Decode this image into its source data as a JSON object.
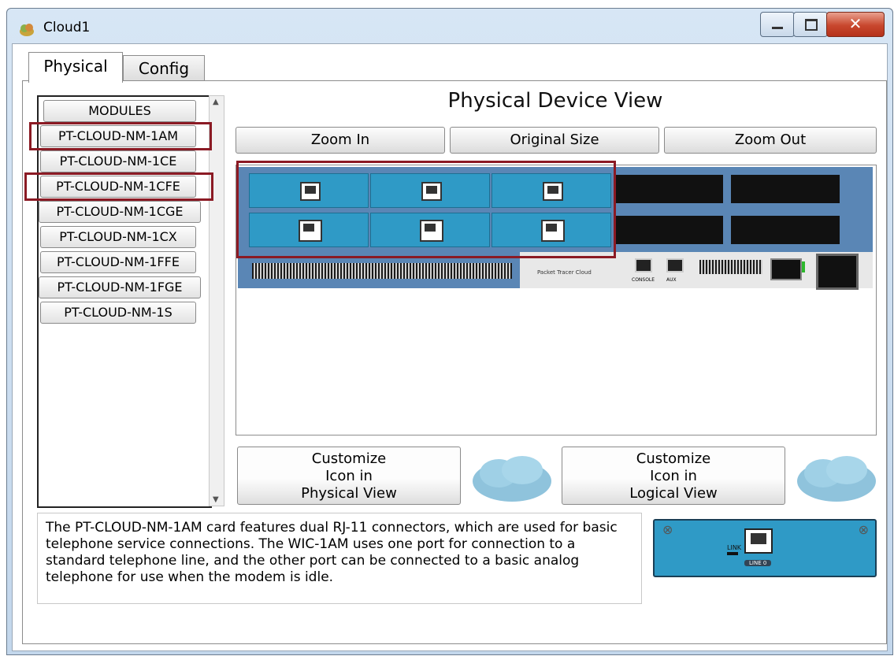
{
  "window": {
    "title": "Cloud1",
    "icon": "cloud-device-icon",
    "controls": [
      "minimize-icon",
      "maximize-icon",
      "close-icon"
    ]
  },
  "tabs": [
    {
      "label": "Physical",
      "active": true
    },
    {
      "label": "Config",
      "active": false
    }
  ],
  "modules": {
    "header": "MODULES",
    "items": [
      "PT-CLOUD-NM-1AM",
      "PT-CLOUD-NM-1CE",
      "PT-CLOUD-NM-1CFE",
      "PT-CLOUD-NM-1CGE",
      "PT-CLOUD-NM-1CX",
      "PT-CLOUD-NM-1FFE",
      "PT-CLOUD-NM-1FGE",
      "PT-CLOUD-NM-1S"
    ],
    "highlighted": [
      "PT-CLOUD-NM-1AM",
      "PT-CLOUD-NM-1CFE"
    ]
  },
  "device_view": {
    "title": "Physical Device View",
    "zoom_in": "Zoom In",
    "original_size": "Original Size",
    "zoom_out": "Zoom Out",
    "device_label": "Packet Tracer Cloud",
    "port_labels": [
      "CONSOLE",
      "AUX"
    ]
  },
  "customize": {
    "physical_line1": "Customize",
    "physical_line2": "Icon in",
    "physical_line3": "Physical View",
    "logical_line1": "Customize",
    "logical_line2": "Icon in",
    "logical_line3": "Logical View"
  },
  "description": "The PT-CLOUD-NM-1AM card features dual RJ-11 connectors, which are used for basic telephone service connections. The WIC-1AM uses one port for connection to a standard telephone line, and the other port can be connected to a basic analog telephone for use when the modem is idle.",
  "module_preview": {
    "link_label": "LINK",
    "port_label": "LINE 0"
  },
  "colors": {
    "highlight": "#8b1a24",
    "device_body": "#5a86b5",
    "module_card": "#2f9ac6"
  }
}
